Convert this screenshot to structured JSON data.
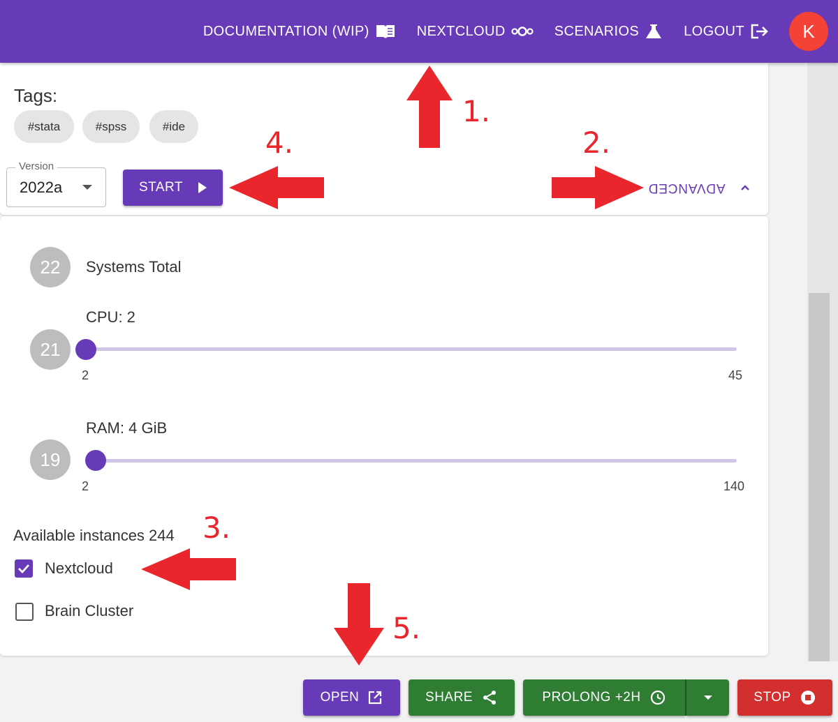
{
  "nav": {
    "documentation": "DOCUMENTATION (WIP)",
    "nextcloud": "NEXTCLOUD",
    "scenarios": "SCENARIOS",
    "logout": "LOGOUT",
    "avatar_letter": "K"
  },
  "tags": {
    "label": "Tags:",
    "items": [
      "#stata",
      "#spss",
      "#ide"
    ]
  },
  "version": {
    "label": "Version",
    "value": "2022a"
  },
  "start_label": "START",
  "advanced_label": "ADVANCED",
  "systems": {
    "badge": "22",
    "label": "Systems Total"
  },
  "cpu": {
    "badge": "21",
    "label": "CPU: 2",
    "min": "2",
    "max": "45",
    "value": 2
  },
  "ram": {
    "badge": "19",
    "label": "RAM: 4 GiB",
    "min": "2",
    "max": "140",
    "value": 4
  },
  "instances": {
    "label": "Available instances 244",
    "options": [
      {
        "label": "Nextcloud",
        "checked": true
      },
      {
        "label": "Brain Cluster",
        "checked": false
      }
    ]
  },
  "actions": {
    "open": "OPEN",
    "share": "SHARE",
    "prolong": "PROLONG +2H",
    "stop": "STOP"
  },
  "annotations": [
    "1.",
    "2.",
    "3.",
    "4.",
    "5."
  ],
  "colors": {
    "primary": "#673ab7",
    "success": "#2e7d32",
    "danger": "#d32f2f",
    "avatar": "#f44336",
    "annotation": "#e8262b"
  }
}
